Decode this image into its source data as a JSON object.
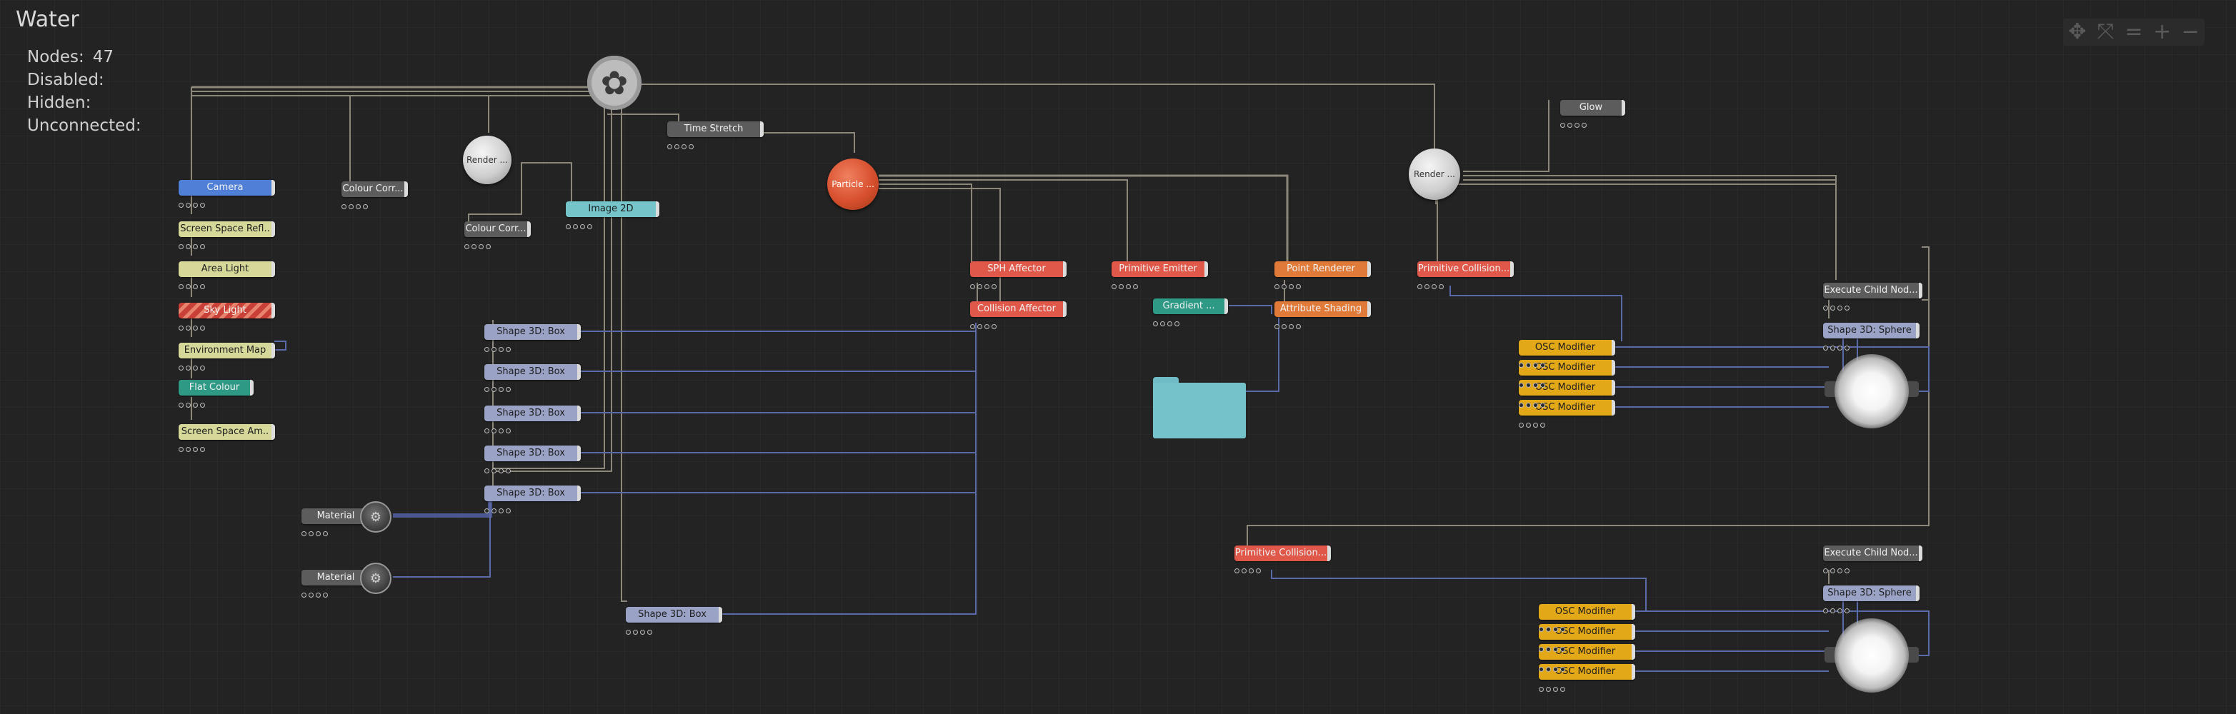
{
  "canvas": {
    "title": "Water",
    "stats": [
      {
        "label": "Nodes:",
        "value": "47"
      },
      {
        "label": "Disabled:",
        "value": ""
      },
      {
        "label": "Hidden:",
        "value": ""
      },
      {
        "label": "Unconnected:",
        "value": ""
      }
    ]
  },
  "toolbar": {
    "items": [
      {
        "name": "move-icon",
        "glyph": "✥"
      },
      {
        "name": "fit-view-icon",
        "glyph": "⤧"
      },
      {
        "name": "reset-zoom-icon",
        "glyph": "="
      },
      {
        "name": "zoom-in-icon",
        "glyph": "+"
      },
      {
        "name": "zoom-out-icon",
        "glyph": "−"
      }
    ]
  },
  "colors": {
    "background": "#232323",
    "wire_gray": "#8c8778",
    "wire_blue": "#5b6aa8",
    "camera": "#4f7fd6",
    "scene": "#d6d89a",
    "shape": "#9aa3c6",
    "affector": "#e0584a",
    "render": "#e07a38",
    "modifier": "#e2a818",
    "image2d": "#74c4ca",
    "gradient": "#2e9a86",
    "utility": "#5c5c5c"
  },
  "nodes": {
    "camera": "Camera",
    "screen_space_reflections": "Screen Space Refl..",
    "area_light": "Area Light",
    "sky_light": "Sky Light",
    "environment_map": "Environment Map",
    "flat_colour": "Flat Colour",
    "screen_space_ambient": "Screen Space Am..",
    "colour_correct_1": "Colour Corr...",
    "colour_correct_2": "Colour Corr...",
    "render_1": "Render ...",
    "image_2d": "Image 2D",
    "time_stretch": "Time Stretch",
    "particle": "Particle ...",
    "render_2": "Render ...",
    "glow": "Glow",
    "shape_box": "Shape 3D: Box",
    "sph_affector": "SPH Affector",
    "collision_affector": "Collision Affector",
    "primitive_emitter": "Primitive Emitter",
    "point_renderer": "Point Renderer",
    "attribute_shading": "Attribute Shading",
    "gradient": "Gradient ...",
    "primitive_collision": "Primitive Collision...",
    "material": "Material",
    "execute_child_nodes": "Execute Child Nod...",
    "shape_sphere": "Shape 3D: Sphere",
    "osc_modifier": "OSC Modifier"
  }
}
